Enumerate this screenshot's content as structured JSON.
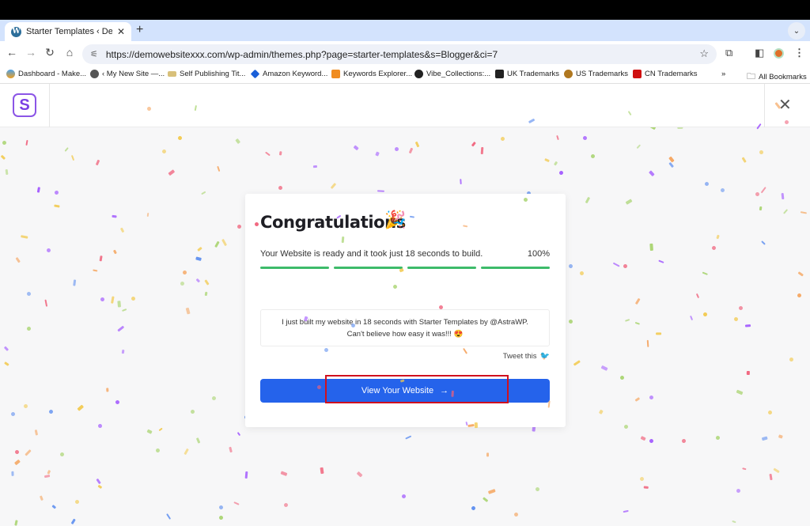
{
  "browser": {
    "tab": {
      "title": "Starter Templates ‹ Demo We",
      "icon": "wordpress-icon"
    },
    "url": "https://demowebsitexxx.com/wp-admin/themes.php?page=starter-templates&s=Blogger&ci=7",
    "bookmarks": [
      {
        "label": "Dashboard - Make...",
        "icon": "dashboard-icon",
        "color": "#f0a020"
      },
      {
        "label": "‹ My New Site —...",
        "icon": "globe-icon",
        "color": "#555555"
      },
      {
        "label": "Self Publishing Tit...",
        "icon": "wings-icon",
        "color": "#c8a040"
      },
      {
        "label": "Amazon Keyword...",
        "icon": "diamond-icon",
        "color": "#1a5fd8"
      },
      {
        "label": "Keywords Explorer...",
        "icon": "a-icon",
        "color": "#f08c20"
      },
      {
        "label": "Vibe_Collections:...",
        "icon": "vibe-icon",
        "color": "#222222"
      },
      {
        "label": "UK Trademarks",
        "icon": "uk-ipo-icon",
        "color": "#222222"
      },
      {
        "label": "US Trademarks",
        "icon": "uspto-icon",
        "color": "#b07820"
      },
      {
        "label": "CN Trademarks",
        "icon": "maple-leaf-icon",
        "color": "#d01010"
      }
    ],
    "overflow_label": "»",
    "all_bookmarks_label": "All Bookmarks"
  },
  "app": {
    "logo_letter": "S",
    "close_label": "✕"
  },
  "card": {
    "title": "Congratulations",
    "title_emoji": "🎉",
    "progress_text": "Your Website is ready and it took just 18 seconds to build.",
    "progress_percent_label": "100%",
    "progress_segments": [
      1.0,
      1.0,
      1.0,
      1.0
    ],
    "tweet_line1": "I just built my website in 18 seconds with Starter Templates by @AstraWP.",
    "tweet_line2": "Can't believe how easy it was!!! 😍",
    "tweet_this_label": "Tweet this",
    "cta_label": "View Your Website",
    "cta_arrow": "→"
  },
  "colors": {
    "accent": "#2563eb",
    "progress": "#3dbb6a",
    "highlight": "#d0101e",
    "confetti": [
      "#a8d46f",
      "#f2c94c",
      "#5b8def",
      "#a259ff",
      "#f0607a",
      "#f5a35c"
    ]
  }
}
